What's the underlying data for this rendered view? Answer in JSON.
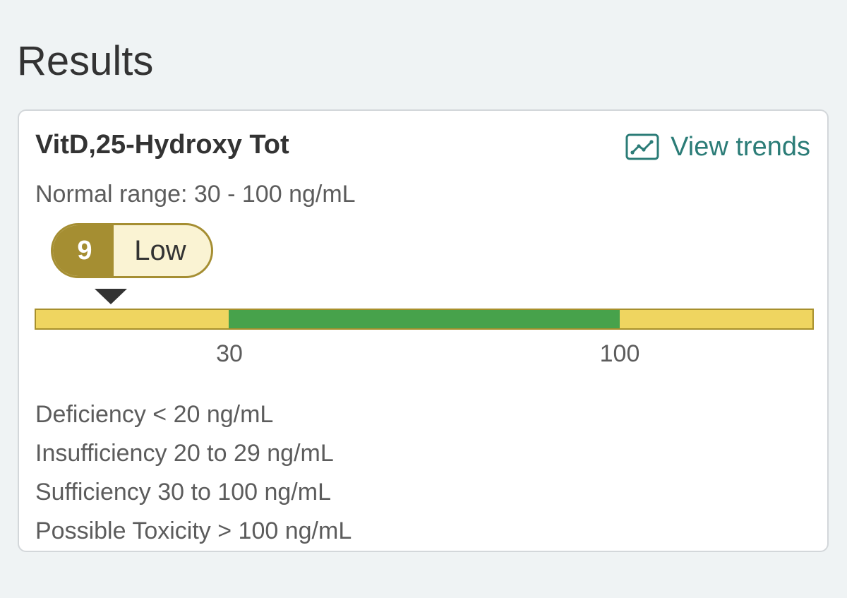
{
  "page": {
    "title": "Results"
  },
  "result_card": {
    "test_name": "VitD,25-Hydroxy Tot",
    "trends_link": {
      "label": "View trends",
      "icon": "trend-chart-icon"
    },
    "normal_range_text": "Normal range: 30 - 100 ng/mL",
    "value": "9",
    "value_numeric": 9,
    "flag": "Low",
    "range_bar": {
      "low": 30,
      "high": 100,
      "tick_labels": [
        "30",
        "100"
      ]
    },
    "reference_notes": [
      "Deficiency < 20 ng/mL",
      "Insufficiency 20 to 29 ng/mL",
      "Sufficiency 30 to 100 ng/mL",
      "Possible Toxicity > 100 ng/mL"
    ]
  },
  "colors": {
    "accent": "#2b7c77",
    "flag_badge": "#a58e32",
    "flag_background": "#faf3d3",
    "range_out": "#efd560",
    "range_normal": "#47a24b"
  }
}
